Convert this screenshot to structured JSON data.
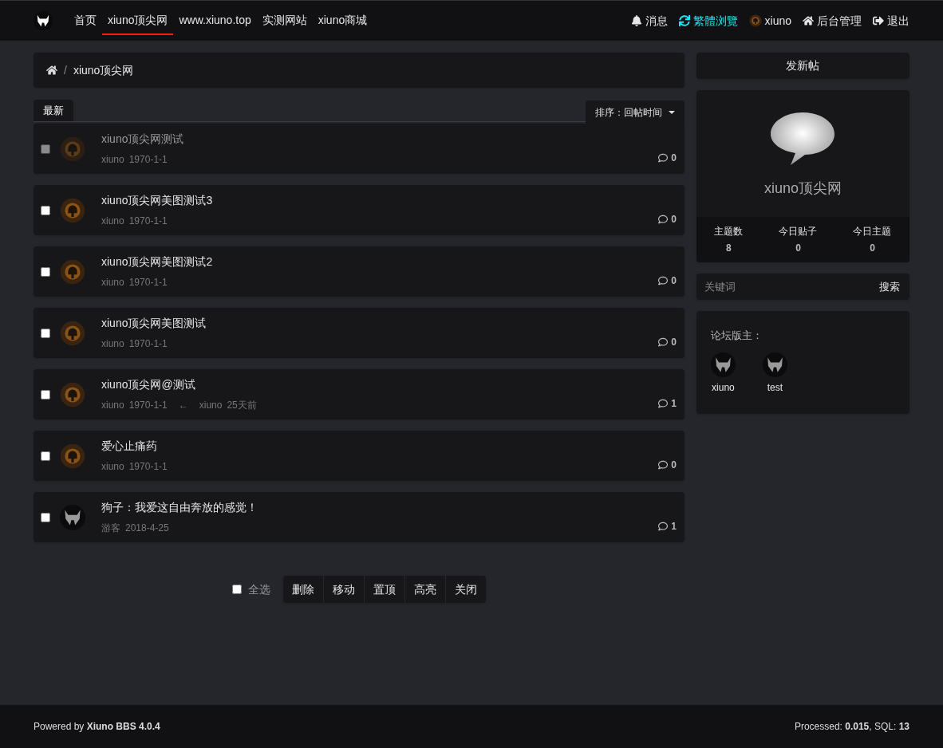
{
  "nav": {
    "links": [
      {
        "label": "首页",
        "selected": false
      },
      {
        "label": "xiuno顶尖网",
        "selected": true
      },
      {
        "label": "www.xiuno.top",
        "selected": false
      },
      {
        "label": "实测网站",
        "selected": false
      },
      {
        "label": "xiuno商城",
        "selected": false
      }
    ],
    "right": [
      {
        "kind": "bell",
        "label": "消息",
        "highlighted": false
      },
      {
        "kind": "sync",
        "label": "繁體浏覽",
        "highlighted": true
      },
      {
        "kind": "avatar",
        "label": "xiuno",
        "highlighted": false
      },
      {
        "kind": "home",
        "label": "后台管理",
        "highlighted": false
      },
      {
        "kind": "signout",
        "label": "退出",
        "highlighted": false
      }
    ]
  },
  "breadcrumb": {
    "separator": "/",
    "items": [
      "xiuno顶尖网"
    ]
  },
  "tabs": [
    {
      "label": "最新",
      "selected": true
    }
  ],
  "sort": {
    "label": "排序：回帖时间"
  },
  "threads": [
    {
      "title": "xiuno顶尖网测试",
      "author": "xiuno",
      "date": "1970-1-1",
      "replies": "0",
      "kind": "user",
      "dimmed": true,
      "checked": false
    },
    {
      "title": "xiuno顶尖网美图测试3",
      "author": "xiuno",
      "date": "1970-1-1",
      "replies": "0",
      "kind": "user",
      "dimmed": false,
      "checked": false
    },
    {
      "title": "xiuno顶尖网美图测试2",
      "author": "xiuno",
      "date": "1970-1-1",
      "replies": "0",
      "kind": "user",
      "dimmed": false,
      "checked": false
    },
    {
      "title": "xiuno顶尖网美图测试",
      "author": "xiuno",
      "date": "1970-1-1",
      "replies": "0",
      "kind": "user",
      "dimmed": false,
      "checked": false
    },
    {
      "title": "xiuno顶尖网@测试",
      "author": "xiuno",
      "date": "1970-1-1",
      "last_reply": {
        "arrow": "←",
        "author": "xiuno",
        "time": "25天前"
      },
      "replies": "1",
      "kind": "user",
      "dimmed": false,
      "checked": false
    },
    {
      "title": "爱心止痛药",
      "author": "xiuno",
      "date": "1970-1-1",
      "replies": "0",
      "kind": "user",
      "dimmed": false,
      "checked": false
    },
    {
      "title": "狗子：我爱这自由奔放的感觉！",
      "author": "游客",
      "date": "2018-4-25",
      "replies": "1",
      "kind": "guest",
      "dimmed": false,
      "checked": false
    }
  ],
  "bulk": {
    "select_all": {
      "label": "全选",
      "checked": false
    },
    "buttons": [
      "删除",
      "移动",
      "置顶",
      "高亮",
      "关闭"
    ]
  },
  "sidebar": {
    "new_thread": "发新帖",
    "forum": {
      "name": "xiuno顶尖网",
      "stats": [
        {
          "label": "主题数",
          "value": "8"
        },
        {
          "label": "今日贴子",
          "value": "0"
        },
        {
          "label": "今日主题",
          "value": "0"
        }
      ]
    },
    "search": {
      "placeholder": "关键词",
      "button": "搜索"
    },
    "moderators": {
      "title": "论坛版主：",
      "users": [
        "xiuno",
        "test"
      ]
    }
  },
  "footer": {
    "left": "Powered by **Xiuno BBS 4.0.4**",
    "right": "Processed: **0.015**, SQL: **13**"
  }
}
